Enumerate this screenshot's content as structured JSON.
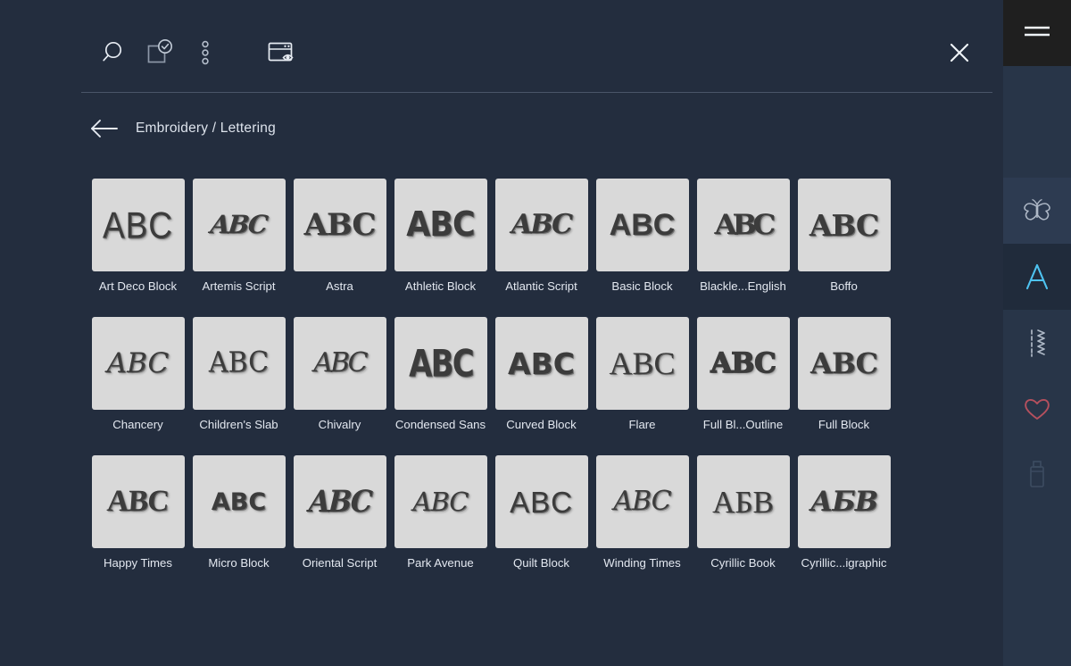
{
  "toolbar": {
    "buttons": [
      {
        "name": "search-icon",
        "label": "Search"
      },
      {
        "name": "select-confirm-icon",
        "label": "Select"
      },
      {
        "name": "more-options-icon",
        "label": "More options"
      },
      {
        "name": "preview-window-icon",
        "label": "Preview"
      }
    ],
    "close_label": "Close"
  },
  "breadcrumb": {
    "back_label": "Back",
    "path": "Embroidery / Lettering"
  },
  "grid": {
    "tiles": [
      {
        "label": "Art Deco Block",
        "sample": "ABC",
        "style": "s-artdeco"
      },
      {
        "label": "Artemis Script",
        "sample": "ABC",
        "style": "s-artemis"
      },
      {
        "label": "Astra",
        "sample": "ABC",
        "style": "s-astra"
      },
      {
        "label": "Athletic Block",
        "sample": "ABC",
        "style": "s-athletic"
      },
      {
        "label": "Atlantic Script",
        "sample": "ABC",
        "style": "s-atlantic"
      },
      {
        "label": "Basic Block",
        "sample": "ABC",
        "style": "s-basic"
      },
      {
        "label": "Blackle...English",
        "sample": "ABC",
        "style": "s-blackletter"
      },
      {
        "label": "Boffo",
        "sample": "ABC",
        "style": "s-boffo"
      },
      {
        "label": "Chancery",
        "sample": "ABC",
        "style": "s-chancery"
      },
      {
        "label": "Children's Slab",
        "sample": "ABC",
        "style": "s-childrens"
      },
      {
        "label": "Chivalry",
        "sample": "ABC",
        "style": "s-chivalry"
      },
      {
        "label": "Condensed Sans",
        "sample": "ABC",
        "style": "s-condensed"
      },
      {
        "label": "Curved Block",
        "sample": "ABC",
        "style": "s-curved"
      },
      {
        "label": "Flare",
        "sample": "ABC",
        "style": "s-flare"
      },
      {
        "label": "Full Bl...Outline",
        "sample": "ABC",
        "style": "s-fullout"
      },
      {
        "label": "Full Block",
        "sample": "ABC",
        "style": "s-fullblock"
      },
      {
        "label": "Happy Times",
        "sample": "ABC",
        "style": "s-happy"
      },
      {
        "label": "Micro Block",
        "sample": "ABC",
        "style": "s-micro"
      },
      {
        "label": "Oriental Script",
        "sample": "ABC",
        "style": "s-oriental"
      },
      {
        "label": "Park Avenue",
        "sample": "ABC",
        "style": "s-park"
      },
      {
        "label": "Quilt Block",
        "sample": "ABC",
        "style": "s-quilt"
      },
      {
        "label": "Winding Times",
        "sample": "ABC",
        "style": "s-winding"
      },
      {
        "label": "Cyrillic Book",
        "sample": "АБВ",
        "style": "s-cyrbook"
      },
      {
        "label": "Cyrillic...igraphic",
        "sample": "АБВ",
        "style": "s-cyrcallig"
      }
    ]
  },
  "rail": {
    "menu_label": "Menu",
    "items": [
      {
        "name": "butterfly-icon",
        "label": "Designs",
        "state": "lit"
      },
      {
        "name": "letter-a-icon",
        "label": "Lettering",
        "state": "active"
      },
      {
        "name": "stitches-icon",
        "label": "Stitches",
        "state": "normal"
      },
      {
        "name": "heart-icon",
        "label": "Favorites",
        "state": "normal"
      },
      {
        "name": "usb-drive-icon",
        "label": "USB",
        "state": "disabled"
      }
    ]
  },
  "colors": {
    "background": "#232d3e",
    "rail": "#283548",
    "swatch": "#d9d9d9",
    "accent": "#4ec3f0",
    "favorite": "#b5505e",
    "menu_block": "#1f1f1f"
  }
}
